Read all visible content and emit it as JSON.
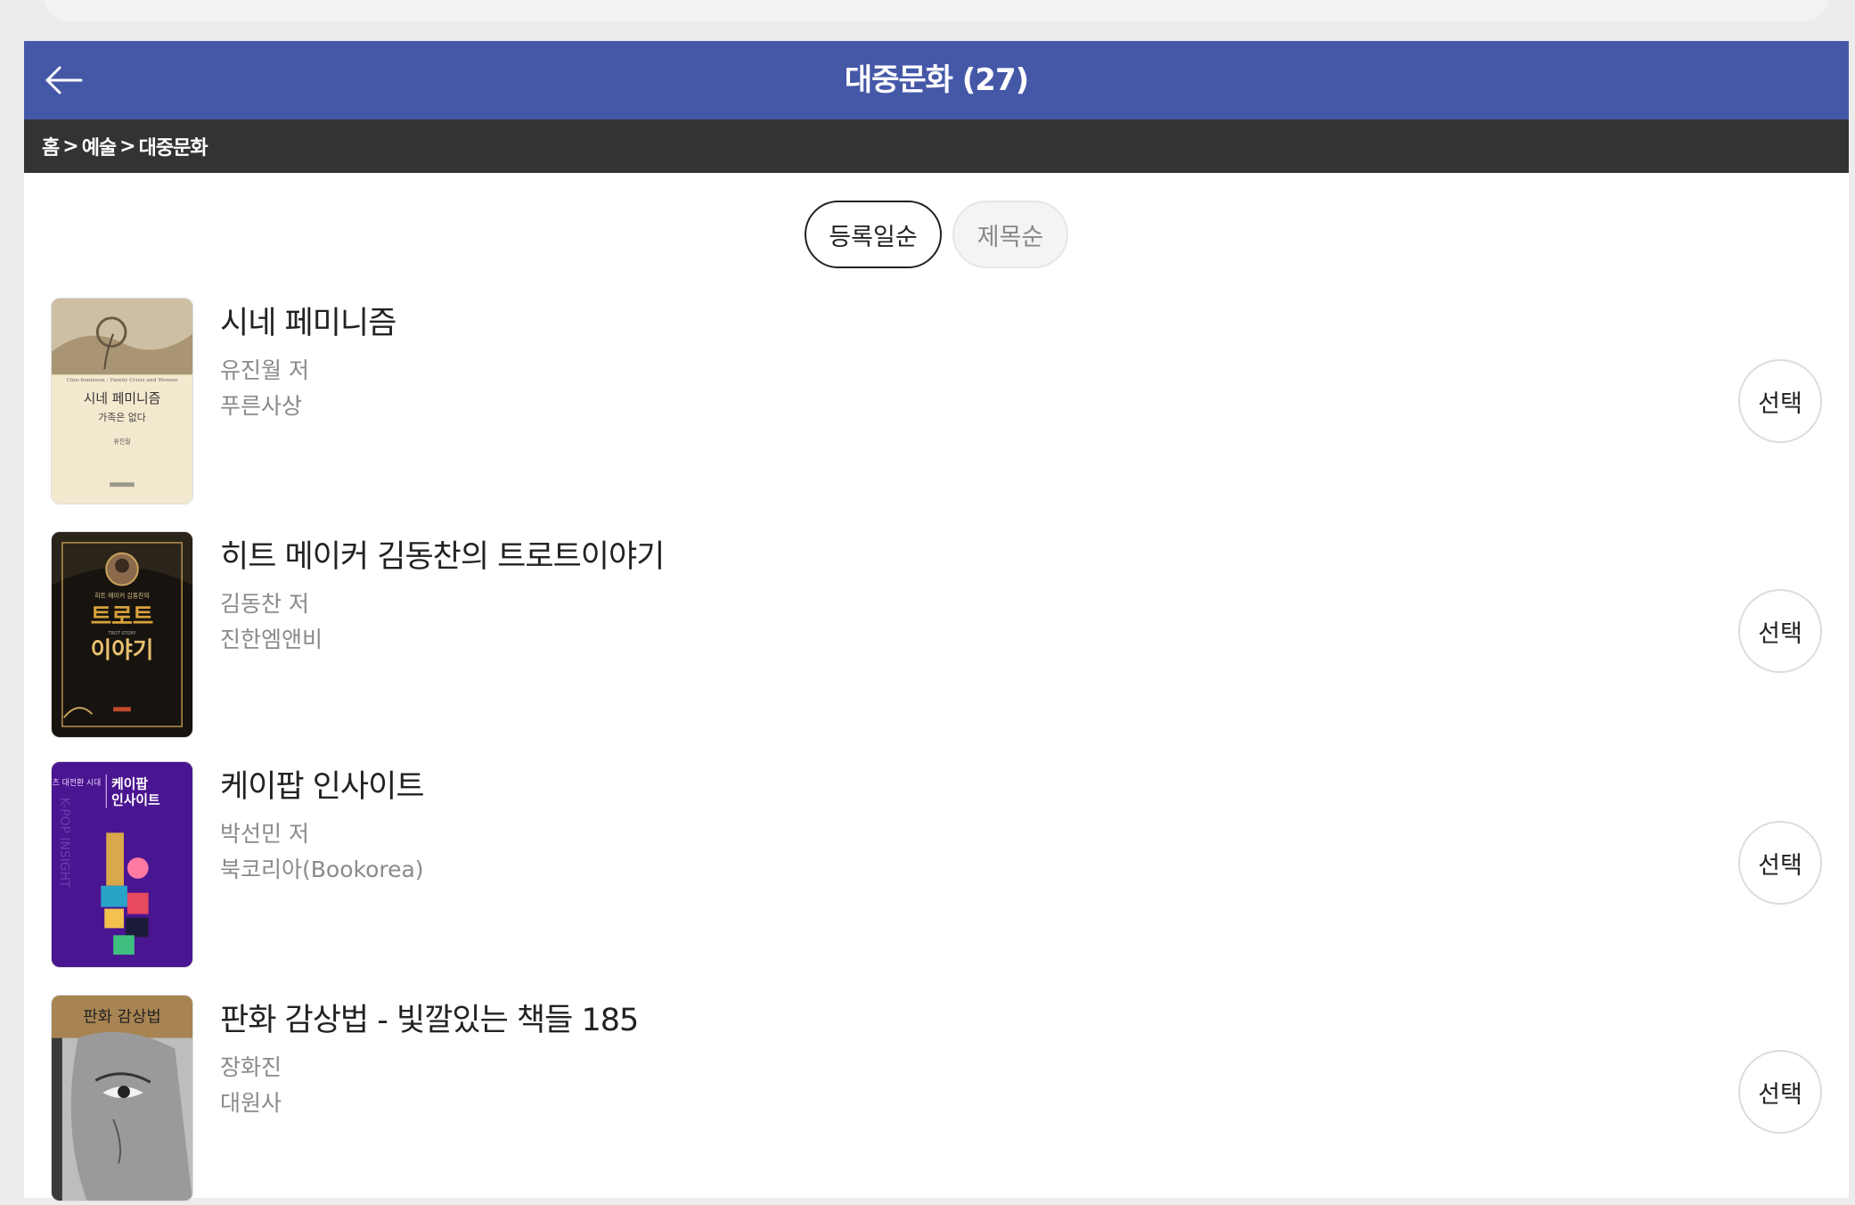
{
  "header": {
    "title": "대중문화 (27)"
  },
  "breadcrumb": {
    "items": [
      "홈",
      "예술",
      "대중문화"
    ],
    "separator": ">"
  },
  "sort": {
    "options": [
      {
        "label": "등록일순",
        "active": true
      },
      {
        "label": "제목순",
        "active": false
      }
    ]
  },
  "books": [
    {
      "title": "시네 페미니즘",
      "author": "유진월 저",
      "publisher": "푸른사상",
      "select_label": "선택",
      "cover": {
        "title": "시네 페미니즘",
        "subtitle": "가족은 없다",
        "english": "Cine-feminism : Family Crisis and Women",
        "author": "유진월"
      }
    },
    {
      "title": "히트 메이커 김동찬의 트로트이야기",
      "author": "김동찬 저",
      "publisher": "진한엠앤비",
      "select_label": "선택",
      "cover": {
        "kicker": "히트 메이커 김동찬의",
        "line1": "트로트",
        "line2": "이야기",
        "english": "TROT STORY"
      }
    },
    {
      "title": "케이팝 인사이트",
      "author": "박선민 저",
      "publisher": "북코리아(Bookorea)",
      "select_label": "선택",
      "cover": {
        "side": "콘텐츠 대전환 시대",
        "title_line1": "케이팝",
        "title_line2": "인사이트",
        "vertical": "K-POP INSIGHT"
      }
    },
    {
      "title": "판화 감상법 - 빛깔있는 책들 185",
      "author": "장화진",
      "publisher": "대원사",
      "select_label": "선택",
      "cover": {
        "title": "판화 감상법"
      }
    }
  ],
  "colors": {
    "header_bg": "#4558a8",
    "breadcrumb_bg": "#333333"
  }
}
